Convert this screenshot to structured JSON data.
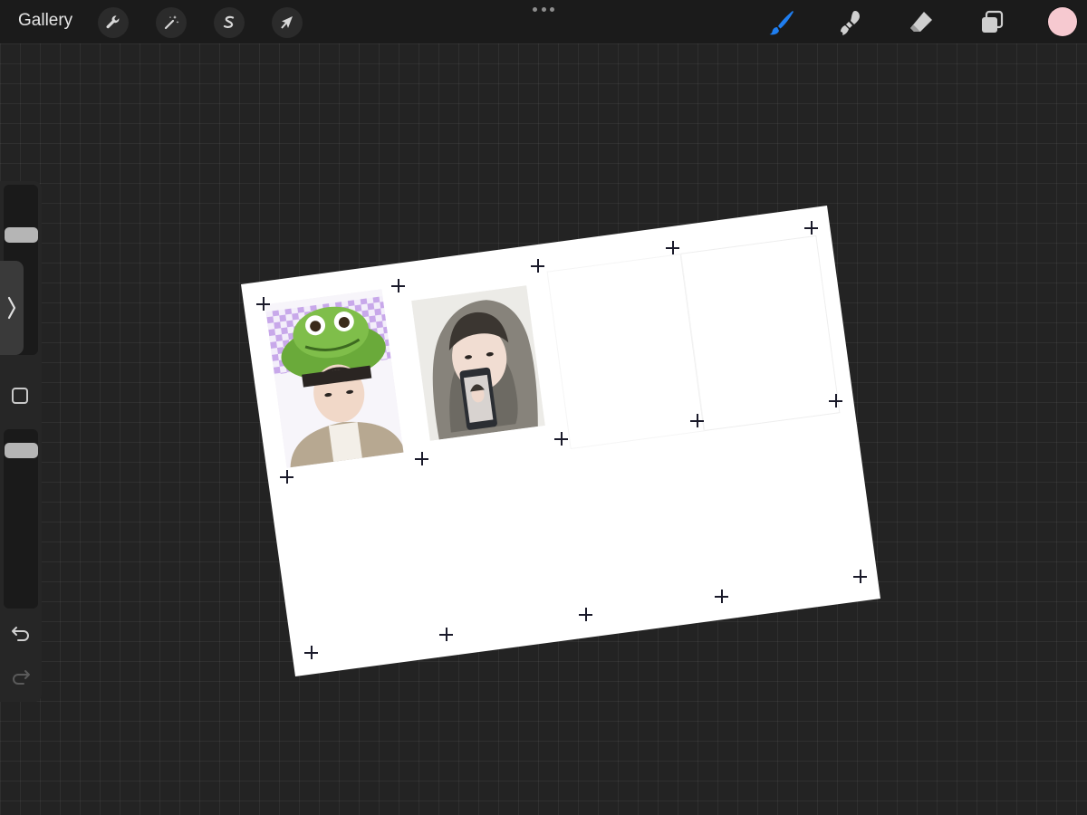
{
  "toolbar": {
    "gallery_label": "Gallery",
    "left_tools": [
      {
        "icon": "wrench-icon",
        "name": "actions"
      },
      {
        "icon": "magic-wand-icon",
        "name": "adjustments"
      },
      {
        "icon": "selection-s-icon",
        "name": "selection"
      },
      {
        "icon": "arrow-cursor-icon",
        "name": "transform"
      }
    ],
    "right_tools": [
      {
        "icon": "brush-icon",
        "name": "brush",
        "active": true
      },
      {
        "icon": "smudge-icon",
        "name": "smudge"
      },
      {
        "icon": "eraser-icon",
        "name": "eraser"
      },
      {
        "icon": "layers-icon",
        "name": "layers"
      }
    ],
    "current_color": "#f6c9d0",
    "active_color": "#1f7ef0"
  },
  "sidebar": {
    "brush_size_level": 0.1,
    "opacity_level": 0.05,
    "icons": [
      "chevron-right-icon",
      "modify-square-icon",
      "undo-icon",
      "redo-icon"
    ]
  },
  "canvas": {
    "background": "#ffffff",
    "photos": [
      {
        "name": "photo-frog-hat",
        "description_icon": "frog-hat-photo"
      },
      {
        "name": "photo-hoodie-phone",
        "description_icon": "hoodie-photo"
      }
    ]
  }
}
